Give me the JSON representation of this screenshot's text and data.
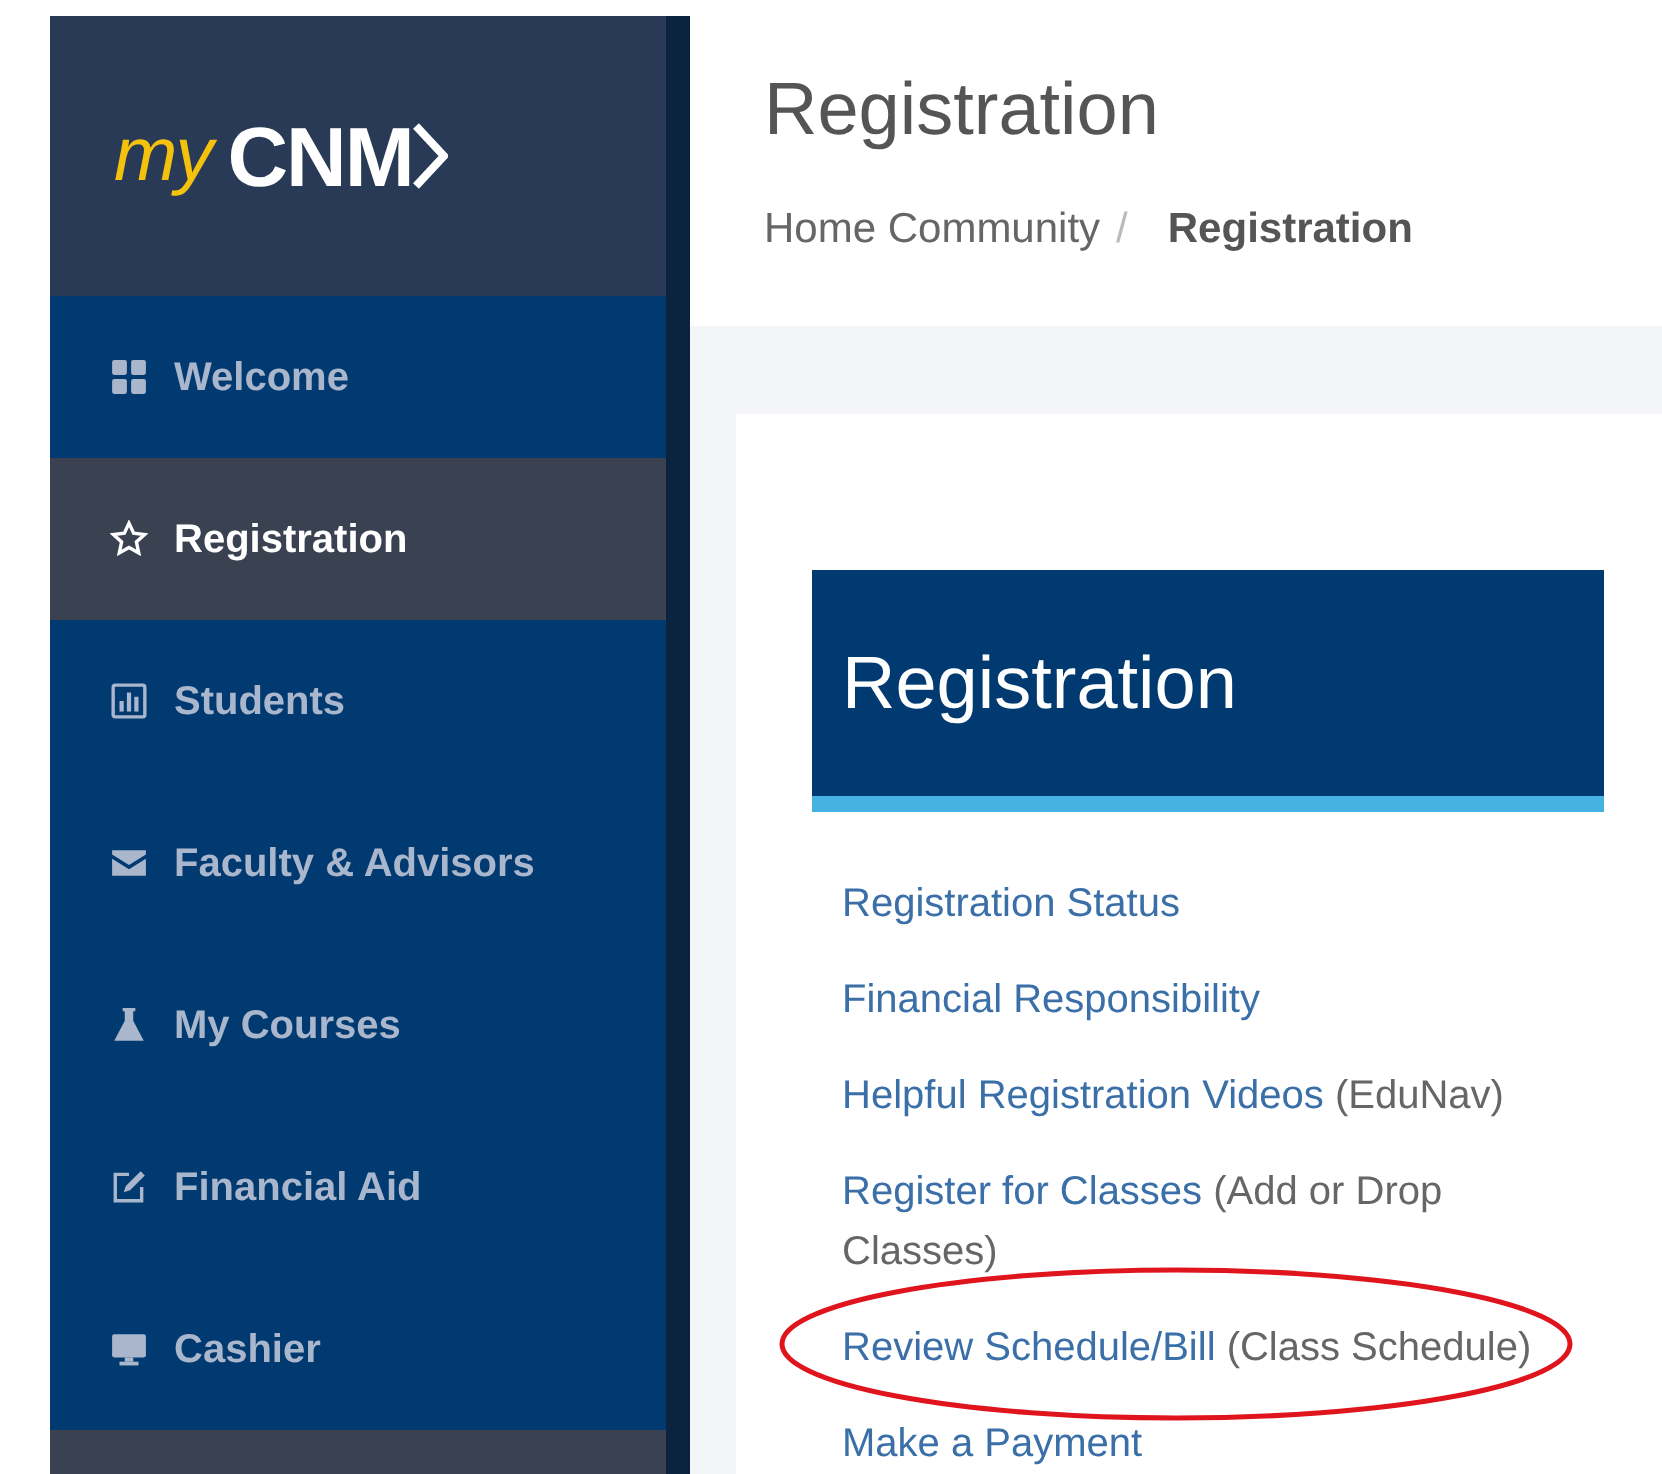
{
  "logo": {
    "prefix": "my",
    "name": "CNM"
  },
  "sidebar": {
    "items": [
      {
        "label": "Welcome",
        "selected": false
      },
      {
        "label": "Registration",
        "selected": true
      },
      {
        "label": "Students",
        "selected": false
      },
      {
        "label": "Faculty & Advisors",
        "selected": false
      },
      {
        "label": "My Courses",
        "selected": false
      },
      {
        "label": "Financial Aid",
        "selected": false
      },
      {
        "label": "Cashier",
        "selected": false
      }
    ]
  },
  "header": {
    "title": "Registration",
    "breadcrumb": [
      {
        "label": "Home Community",
        "current": false
      },
      {
        "label": "Registration",
        "current": true
      }
    ],
    "separator": "/"
  },
  "panel": {
    "title": "Registration",
    "links": [
      {
        "label": "Registration Status",
        "highlighted": false
      },
      {
        "label": "Financial Responsibility",
        "highlighted": false
      },
      {
        "label": "Helpful Registration Videos",
        "note": "(EduNav)",
        "highlighted": false
      },
      {
        "label": "Register for Classes",
        "note": "(Add or Drop Classes)",
        "highlighted": false
      },
      {
        "label": "Review Schedule/Bill",
        "note": "(Class Schedule)",
        "highlighted": true
      },
      {
        "label": "Make a Payment",
        "highlighted": false
      }
    ]
  }
}
